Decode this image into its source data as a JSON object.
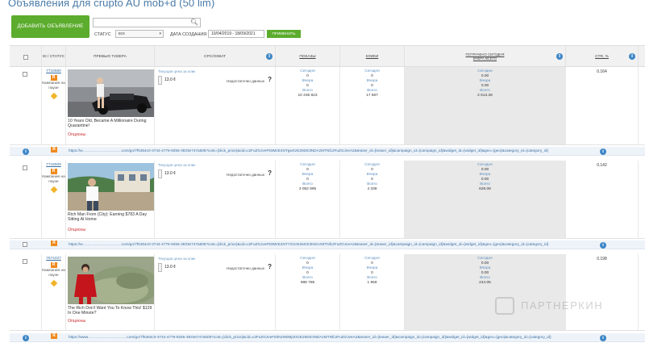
{
  "page_title": "Объявления для crupto AU mob+d (50 lim)",
  "toolbar": {
    "add_button": "ДОБАВИТЬ ОБЪЯВЛЕНИЕ",
    "status_label": "СТАТУС",
    "status_value": "все",
    "date_label": "ДАТА СОЗДАНИЯ",
    "date_value": "10/04/2019 - 18/09/2021",
    "apply_button": "ПРИМЕНИТЬ"
  },
  "table": {
    "headers": {
      "id_status": "ID / СТАТУС",
      "preview": "ПРЕВЬЮ ТИЗЕРА",
      "cpc": "CPC/ОХВАТ",
      "impressions": "ПОКАЗЫ",
      "clicks": "КЛИКИ",
      "spent": "ПОТРАЧЕНО СЕГОДНЯ ВЧЕРА ВСЕГО",
      "ctr": "CTR, %"
    },
    "rows": [
      {
        "id": "7716580",
        "badge": "R",
        "status": "Кампания на паузе",
        "caption": "10 Years Old, Became A Millionaire During Quarantine!",
        "topic": "Опционы",
        "cpc_label": "Текущая цена за клик",
        "cpc_value": "13.0 ¢",
        "cpc_note": "Недостаточно данных",
        "impressions": {
          "today_label": "Сегодня",
          "today": "0",
          "yesterday_label": "Вчера",
          "yesterday": "0",
          "total_label": "Всего",
          "total": "10 436 823"
        },
        "clicks": {
          "today_label": "Сегодня",
          "today": "0",
          "yesterday_label": "Вчера",
          "yesterday": "0",
          "total_label": "Всего",
          "total": "17 667"
        },
        "spent": {
          "today_label": "Сегодня",
          "today": "0.00",
          "yesterday_label": "Вчера",
          "yesterday": "0.00",
          "total_label": "Всего",
          "total": "2 613.28"
        },
        "ctr": "0.164",
        "url": "https://w………………………….com/go/7f6364c0-3744-4776-9255-3833e747a605?cost={click_price}&cid=c2FuZGJveF83MzE4NTgwXzE2MzE3NDAzMTNfc2FuZGJveA2&teaser_id={teaser_id}&campaign_id={campaign_id}&widget_id={widget_id}&geo={geo}&category_id={category_id}"
      },
      {
        "id": "7716509",
        "badge": "R",
        "status": "Кампания на паузе",
        "caption": "Rich Man From {City}: Earning $783 A Day Sitting At Home",
        "topic": "Опционы",
        "cpc_label": "Текущая цена за клик",
        "cpc_value": "13.0 ¢",
        "cpc_note": "Недостаточно данных",
        "impressions": {
          "today_label": "Сегодня",
          "today": "0",
          "yesterday_label": "Вчера",
          "yesterday": "0",
          "total_label": "Всего",
          "total": "3 052 995"
        },
        "clicks": {
          "today_label": "Сегодня",
          "today": "0",
          "yesterday_label": "Вчера",
          "yesterday": "0",
          "total_label": "Всего",
          "total": "4 338"
        },
        "spent": {
          "today_label": "Сегодня",
          "today": "0.00",
          "yesterday_label": "Вчера",
          "yesterday": "0.00",
          "total_label": "Всего",
          "total": "626.08"
        },
        "ctr": "0.142",
        "url": "https://w………………………….com/go/7f6364c0-3744-4776-9255-3833e747a605?cost={click_price}&cid=c2FuZGJveF83MzE4NTYSXzE2MzE3NDAzMTNfc2FuZGJveA2&teaser_id={teaser_id}&campaign_id={campaign_id}&widget_id={widget_id}&geo={geo}&category_id={category_id}"
      },
      {
        "id": "7674227",
        "badge": "R",
        "status": "Кампания на паузе",
        "caption": "The Rich Don't Want You To Know This! $129 In One Minute?",
        "topic": "Опционы",
        "cpc_label": "Текущая цена за клик",
        "cpc_value": "13.0 ¢",
        "cpc_note": "Недостаточно данных",
        "impressions": {
          "today_label": "Сегодня",
          "today": "0",
          "yesterday_label": "Вчера",
          "yesterday": "0",
          "total_label": "Всего",
          "total": "988 785"
        },
        "clicks": {
          "today_label": "Сегодня",
          "today": "0",
          "yesterday_label": "Вчера",
          "yesterday": "0",
          "total_label": "Всего",
          "total": "1 958"
        },
        "spent": {
          "today_label": "Сегодня",
          "today": "0.00",
          "yesterday_label": "Вчера",
          "yesterday": "0.00",
          "total_label": "Всего",
          "total": "244.05"
        },
        "ctr": "0.198",
        "url": "https://www………………………….com/go/7f6364c0-3744-4776-9255-3833e747a605?cost={click_price}&cid=c2FuZGJveF83NzM0MjI3XzE2MzE3NDAzMTNfc2FuZGJveA2&teaser_id={teaser_id}&campaign_id={campaign_id}&widget_id={widget_id}&geo={geo}&category_id={category_id}"
      }
    ]
  },
  "watermark": "ПАРТНЕРКИН",
  "colors": {
    "accent_green": "#5cac2d",
    "link_blue": "#3a6fa0",
    "badge_orange": "#ef8a1e",
    "info_blue": "#3d86c6",
    "topic_red": "#cc3333"
  }
}
